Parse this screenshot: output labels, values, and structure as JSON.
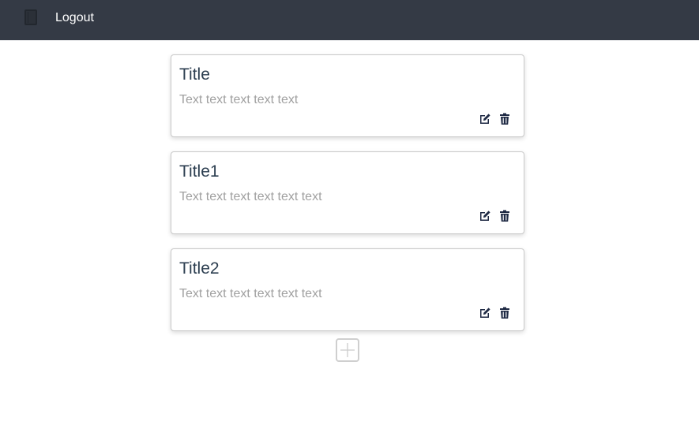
{
  "navbar": {
    "logo_icon": "notebook-icon",
    "logout_label": "Logout"
  },
  "cards": [
    {
      "title": "Title",
      "text": "Text text text text text"
    },
    {
      "title": "Title1",
      "text": "Text text text text text text"
    },
    {
      "title": "Title2",
      "text": "Text text text text text text"
    }
  ],
  "icons": {
    "edit": "edit-icon",
    "delete": "trash-icon",
    "add": "plus-icon"
  },
  "colors": {
    "navbar_bg": "#343a45",
    "title": "#2c3e50",
    "body_text": "#a0a0a0",
    "icon": "#1f2a44"
  }
}
